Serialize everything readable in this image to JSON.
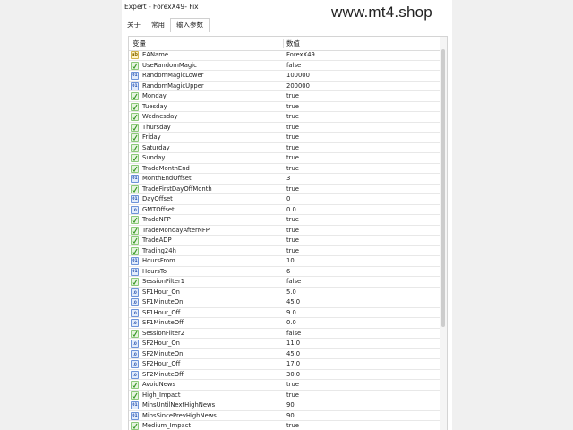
{
  "window": {
    "title": "Expert - ForexX49- Fix"
  },
  "watermark": "www.mt4.shop",
  "tabs": [
    {
      "label": "关于",
      "active": false
    },
    {
      "label": "常用",
      "active": false
    },
    {
      "label": "输入参数",
      "active": true
    }
  ],
  "grid": {
    "header": {
      "name": "变量",
      "value": "数值"
    },
    "rows": [
      {
        "name": "EAName",
        "value": "ForexX49",
        "type": "string"
      },
      {
        "name": "UseRandomMagic",
        "value": "false",
        "type": "bool"
      },
      {
        "name": "RandomMagicLower",
        "value": "100000",
        "type": "int"
      },
      {
        "name": "RandomMagicUpper",
        "value": "200000",
        "type": "int"
      },
      {
        "name": "Monday",
        "value": "true",
        "type": "bool"
      },
      {
        "name": "Tuesday",
        "value": "true",
        "type": "bool"
      },
      {
        "name": "Wednesday",
        "value": "true",
        "type": "bool"
      },
      {
        "name": "Thursday",
        "value": "true",
        "type": "bool"
      },
      {
        "name": "Friday",
        "value": "true",
        "type": "bool"
      },
      {
        "name": "Saturday",
        "value": "true",
        "type": "bool"
      },
      {
        "name": "Sunday",
        "value": "true",
        "type": "bool"
      },
      {
        "name": "TradeMonthEnd",
        "value": "true",
        "type": "bool"
      },
      {
        "name": "MonthEndOffset",
        "value": "3",
        "type": "int"
      },
      {
        "name": "TradeFirstDayOffMonth",
        "value": "true",
        "type": "bool"
      },
      {
        "name": "DayOffset",
        "value": "0",
        "type": "int"
      },
      {
        "name": "GMTOffset",
        "value": "0.0",
        "type": "double"
      },
      {
        "name": "TradeNFP",
        "value": "true",
        "type": "bool"
      },
      {
        "name": "TradeMondayAfterNFP",
        "value": "true",
        "type": "bool"
      },
      {
        "name": "TradeADP",
        "value": "true",
        "type": "bool"
      },
      {
        "name": "Trading24h",
        "value": "true",
        "type": "bool"
      },
      {
        "name": "HoursFrom",
        "value": "10",
        "type": "int"
      },
      {
        "name": "HoursTo",
        "value": "6",
        "type": "int"
      },
      {
        "name": "SessionFilter1",
        "value": "false",
        "type": "bool"
      },
      {
        "name": "SF1Hour_On",
        "value": "5.0",
        "type": "double"
      },
      {
        "name": "SF1MinuteOn",
        "value": "45.0",
        "type": "double"
      },
      {
        "name": "SF1Hour_Off",
        "value": "9.0",
        "type": "double"
      },
      {
        "name": "SF1MinuteOff",
        "value": "0.0",
        "type": "double"
      },
      {
        "name": "SessionFilter2",
        "value": "false",
        "type": "bool"
      },
      {
        "name": "SF2Hour_On",
        "value": "11.0",
        "type": "double"
      },
      {
        "name": "SF2MinuteOn",
        "value": "45.0",
        "type": "double"
      },
      {
        "name": "SF2Hour_Off",
        "value": "17.0",
        "type": "double"
      },
      {
        "name": "SF2MinuteOff",
        "value": "30.0",
        "type": "double"
      },
      {
        "name": "AvoidNews",
        "value": "true",
        "type": "bool"
      },
      {
        "name": "High_Impact",
        "value": "true",
        "type": "bool"
      },
      {
        "name": "MinsUntilNextHighNews",
        "value": "90",
        "type": "int"
      },
      {
        "name": "MinsSincePrevHighNews",
        "value": "90",
        "type": "int"
      },
      {
        "name": "Medium_Impact",
        "value": "true",
        "type": "bool"
      }
    ]
  },
  "icons": {
    "bool": "bool-param-icon",
    "int": "int-param-icon",
    "double": "double-param-icon",
    "string": "string-param-icon"
  },
  "colors": {
    "bool_icon": "#8cc97a",
    "numeric_icon": "#6d93d8",
    "string_icon": "#d2b34a"
  }
}
